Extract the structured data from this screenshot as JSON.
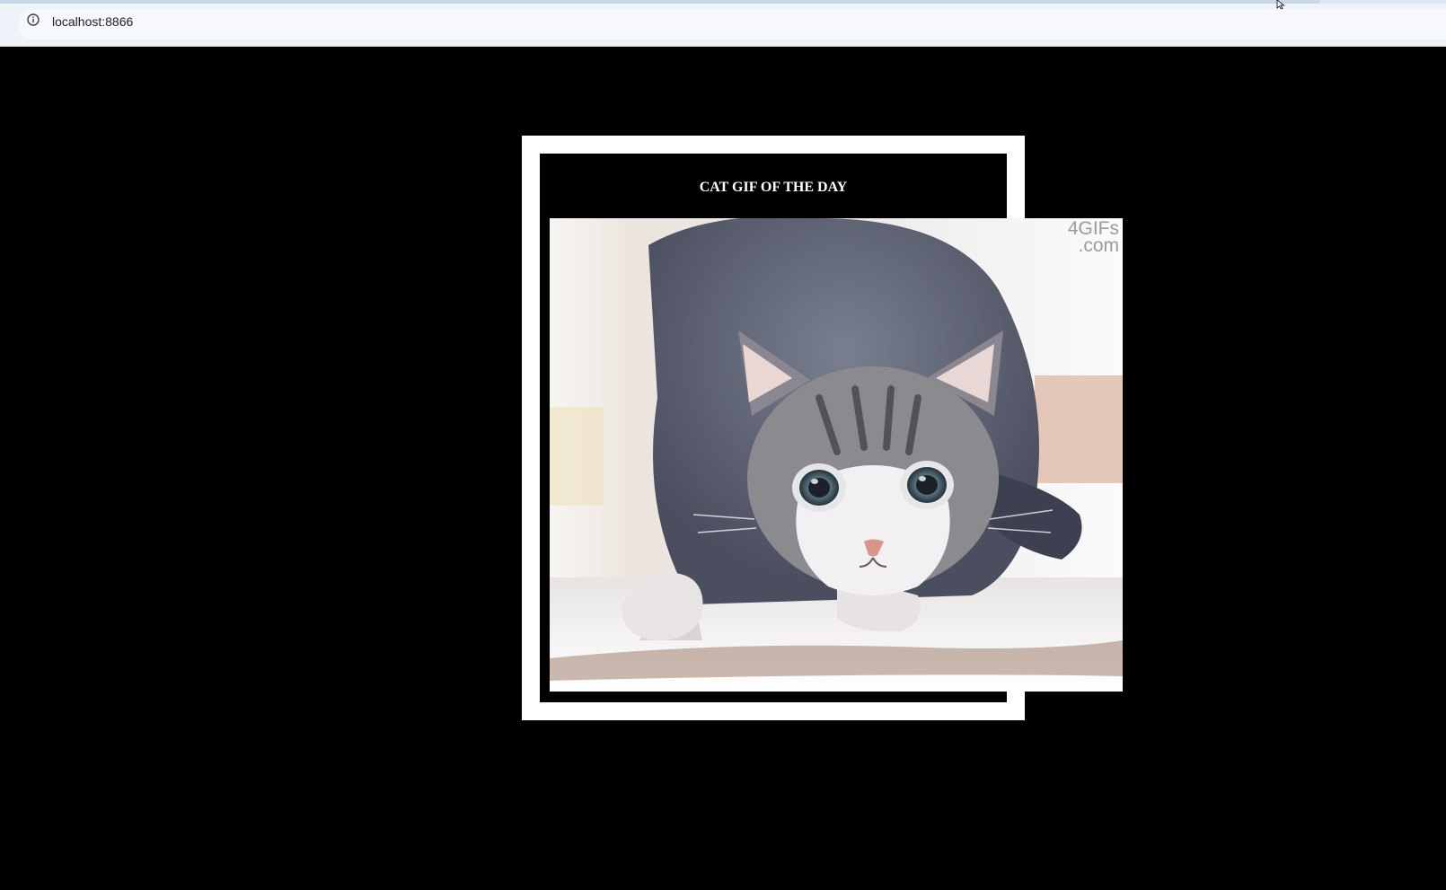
{
  "browser": {
    "url": "localhost:8866",
    "icons": {
      "site_info": "info-circle-icon",
      "cursor": "mouse-pointer-icon"
    }
  },
  "card": {
    "title": "CAT GIF OF THE DAY",
    "image": {
      "subject": "cat-crouching-gif",
      "watermark_line1": "4GIFs",
      "watermark_line2": ".com"
    }
  },
  "colors": {
    "page_background": "#000000",
    "frame": "#ffffff",
    "title_text": "#ffffff"
  }
}
